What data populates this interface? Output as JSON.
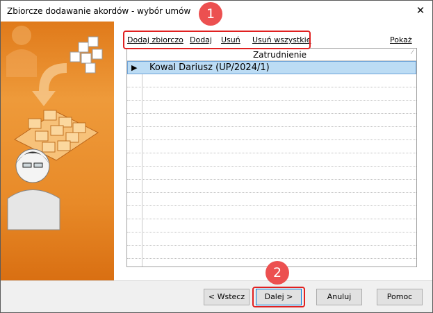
{
  "window": {
    "title": "Zbiorcze dodawanie akordów - wybór umów",
    "close_glyph": "✕"
  },
  "toolbar": {
    "links": {
      "add_bulk": "Dodaj zbiorczo",
      "add": "Dodaj",
      "remove": "Usuń",
      "remove_all": "Usuń wszystkie",
      "show": "Pokaż"
    }
  },
  "grid": {
    "column_header": "Zatrudnienie",
    "sort_glyph": "⁄",
    "selected_pointer": "▶",
    "rows": [
      {
        "label": "Kowal Dariusz (UP/2024/1)",
        "selected": true
      }
    ]
  },
  "annotations": {
    "badge_1": "1",
    "badge_2": "2",
    "color": "#e02020"
  },
  "buttons": {
    "back": "< Wstecz",
    "next": "Dalej >",
    "cancel": "Anuluj",
    "help": "Pomoc"
  },
  "colors": {
    "side_art_orange": "#e88a28",
    "selection": "#bcdcf4"
  }
}
